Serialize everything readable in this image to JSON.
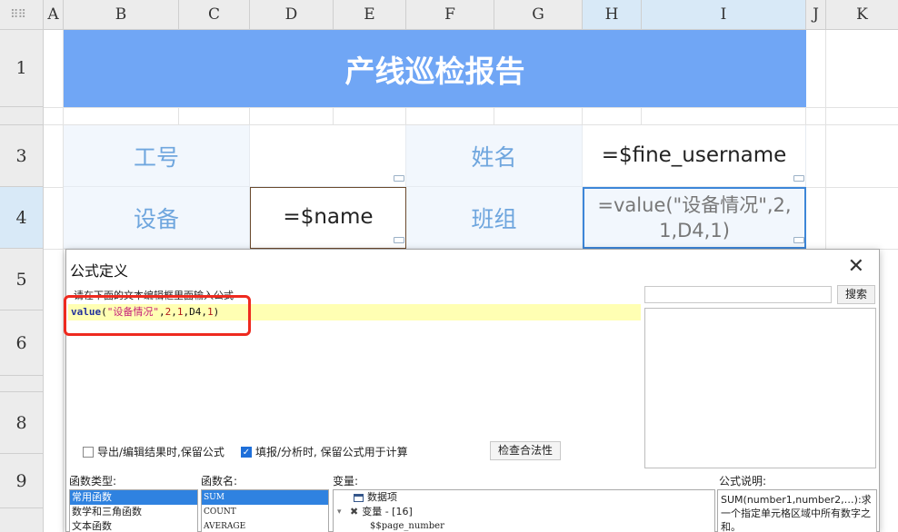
{
  "sheet": {
    "columns": [
      "A",
      "B",
      "C",
      "D",
      "E",
      "F",
      "G",
      "H",
      "I",
      "J",
      "K"
    ],
    "rows": [
      "1",
      "3",
      "4",
      "5",
      "6",
      "8",
      "9"
    ],
    "title": "产线巡检报告",
    "cells": {
      "b3": "工号",
      "f3": "姓名",
      "h3": "=$fine_username",
      "b4": "设备",
      "d4": "=$name",
      "f4": "班组",
      "h4_line1": "=value(\"设备情况\",2,",
      "h4_line2": "1,D4,1)"
    }
  },
  "dialog": {
    "title": "公式定义",
    "hint": "请在下面的文本编辑框里面输入公式",
    "formula": {
      "fn": "value",
      "open": "(",
      "str": "\"设备情况\"",
      "comma1": ",",
      "n1": "2",
      "comma2": ",",
      "n2": "1",
      "comma3": ",",
      "ref": "D4",
      "comma4": ",",
      "n3": "1",
      "close": ")"
    },
    "search_placeholder": "",
    "search_button": "搜索",
    "keep_formula_label": "导出/编辑结果时,保留公式",
    "keep_formula_checked": false,
    "fill_keep_label": "填报/分析时, 保留公式用于计算",
    "fill_keep_checked": true,
    "check_button": "检查合法性",
    "func_type_label": "函数类型:",
    "func_types": [
      "常用函数",
      "数学和三角函数",
      "文本函数"
    ],
    "func_name_label": "函数名:",
    "func_names": [
      "SUM",
      "COUNT",
      "AVERAGE"
    ],
    "variables_label": "变量:",
    "tree": {
      "item1": "数据项",
      "item2": "变量 - [16]",
      "item3": "$$page_number"
    },
    "desc_label": "公式说明:",
    "description": "SUM(number1,number2,…):求一个指定单元格区域中所有数字之和。"
  }
}
